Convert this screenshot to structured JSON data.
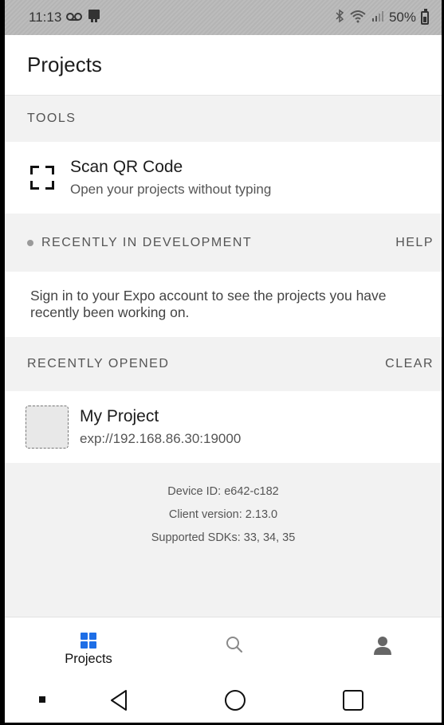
{
  "status_bar": {
    "time": "11:13",
    "battery": "50%"
  },
  "header": {
    "title": "Projects"
  },
  "tools": {
    "section_label": "TOOLS",
    "scan": {
      "title": "Scan QR Code",
      "subtitle": "Open your projects without typing"
    }
  },
  "recent_dev": {
    "section_label": "RECENTLY IN DEVELOPMENT",
    "action_label": "HELP",
    "message": "Sign in to your Expo account to see the projects you have recently been working on."
  },
  "recent_opened": {
    "section_label": "RECENTLY OPENED",
    "action_label": "CLEAR",
    "projects": [
      {
        "name": "My Project",
        "url": "exp://192.168.86.30:19000"
      }
    ]
  },
  "info": {
    "device_id": "Device ID: e642-c182",
    "client_version": "Client version: 2.13.0",
    "sdks": "Supported SDKs: 33, 34, 35"
  },
  "tabs": [
    {
      "label": "Projects",
      "icon": "grid-icon",
      "active": true,
      "color": "#1e6ee6"
    },
    {
      "label": "",
      "icon": "search-icon"
    },
    {
      "label": "",
      "icon": "person-icon"
    }
  ],
  "nav": {
    "icons": [
      "menu-square-icon",
      "back-triangle-icon",
      "home-circle-icon",
      "recents-square-icon"
    ]
  }
}
